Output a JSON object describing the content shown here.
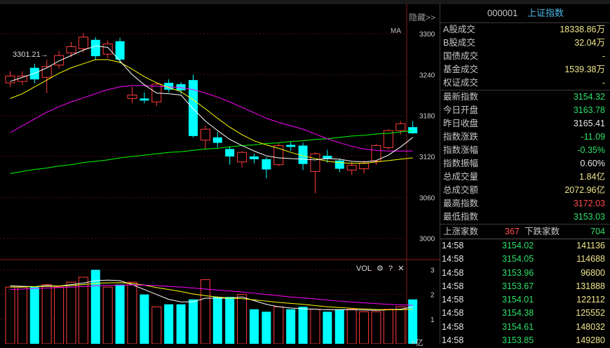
{
  "chart": {
    "hide_label": "隐藏>>",
    "ma_label": "MA",
    "peak_label": "3301.21→",
    "unit_label": "亿",
    "vol_label": "VOL",
    "settings_icon": "gear-icon",
    "help_label": "?",
    "close_label": "✕",
    "colors": {
      "up": "#ff3b3b",
      "down": "#00ffff",
      "ma5": "#ffffff",
      "ma10": "#ffff00",
      "ma20": "#ff00ff",
      "ma60": "#00ff00",
      "grid": "#4a1010"
    }
  },
  "chart_data": [
    {
      "type": "candlestick",
      "title": "",
      "y_ticks": [
        3000,
        3060,
        3120,
        3180,
        3240,
        3300
      ],
      "ylim": [
        2975,
        3335
      ],
      "candles": [
        {
          "o": 3228,
          "c": 3238,
          "h": 3245,
          "l": 3222
        },
        {
          "o": 3230,
          "c": 3238,
          "h": 3245,
          "l": 3225
        },
        {
          "o": 3250,
          "c": 3233,
          "h": 3256,
          "l": 3227
        },
        {
          "o": 3236,
          "c": 3252,
          "h": 3262,
          "l": 3213
        },
        {
          "o": 3254,
          "c": 3268,
          "h": 3275,
          "l": 3249
        },
        {
          "o": 3272,
          "c": 3281,
          "h": 3288,
          "l": 3266
        },
        {
          "o": 3278,
          "c": 3295,
          "h": 3301,
          "l": 3272
        },
        {
          "o": 3291,
          "c": 3267,
          "h": 3295,
          "l": 3261
        },
        {
          "o": 3270,
          "c": 3285,
          "h": 3290,
          "l": 3264
        },
        {
          "o": 3289,
          "c": 3262,
          "h": 3294,
          "l": 3257
        },
        {
          "o": 3205,
          "c": 3210,
          "h": 3222,
          "l": 3198
        },
        {
          "o": 3205,
          "c": 3202,
          "h": 3214,
          "l": 3198
        },
        {
          "o": 3200,
          "c": 3226,
          "h": 3228,
          "l": 3194
        },
        {
          "o": 3228,
          "c": 3218,
          "h": 3233,
          "l": 3214
        },
        {
          "o": 3226,
          "c": 3217,
          "h": 3229,
          "l": 3212
        },
        {
          "o": 3232,
          "c": 3150,
          "h": 3240,
          "l": 3148
        },
        {
          "o": 3144,
          "c": 3160,
          "h": 3165,
          "l": 3130
        },
        {
          "o": 3148,
          "c": 3140,
          "h": 3156,
          "l": 3133
        },
        {
          "o": 3131,
          "c": 3120,
          "h": 3135,
          "l": 3108
        },
        {
          "o": 3112,
          "c": 3126,
          "h": 3128,
          "l": 3104
        },
        {
          "o": 3120,
          "c": 3116,
          "h": 3124,
          "l": 3110
        },
        {
          "o": 3116,
          "c": 3101,
          "h": 3119,
          "l": 3088
        },
        {
          "o": 3108,
          "c": 3136,
          "h": 3140,
          "l": 3106
        },
        {
          "o": 3137,
          "c": 3134,
          "h": 3142,
          "l": 3128
        },
        {
          "o": 3136,
          "c": 3109,
          "h": 3140,
          "l": 3100
        },
        {
          "o": 3098,
          "c": 3124,
          "h": 3126,
          "l": 3066
        },
        {
          "o": 3121,
          "c": 3117,
          "h": 3130,
          "l": 3111
        },
        {
          "o": 3114,
          "c": 3102,
          "h": 3117,
          "l": 3097
        },
        {
          "o": 3100,
          "c": 3107,
          "h": 3112,
          "l": 3093
        },
        {
          "o": 3102,
          "c": 3110,
          "h": 3114,
          "l": 3095
        },
        {
          "o": 3113,
          "c": 3136,
          "h": 3138,
          "l": 3108
        },
        {
          "o": 3133,
          "c": 3158,
          "h": 3160,
          "l": 3130
        },
        {
          "o": 3158,
          "c": 3168,
          "h": 3172,
          "l": 3152
        },
        {
          "o": 3163,
          "c": 3154,
          "h": 3172,
          "l": 3153
        }
      ],
      "ma5": [
        3230,
        3236,
        3242,
        3250,
        3260,
        3268,
        3276,
        3282,
        3280,
        3260,
        3240,
        3225,
        3213,
        3212,
        3210,
        3190,
        3172,
        3158,
        3145,
        3136,
        3128,
        3121,
        3118,
        3117,
        3116,
        3115,
        3117,
        3116,
        3113,
        3112,
        3114,
        3122,
        3134,
        3148
      ],
      "ma10": [
        3205,
        3212,
        3222,
        3232,
        3242,
        3250,
        3256,
        3262,
        3262,
        3258,
        3248,
        3237,
        3228,
        3221,
        3215,
        3203,
        3190,
        3176,
        3163,
        3152,
        3143,
        3137,
        3132,
        3126,
        3121,
        3117,
        3113,
        3111,
        3110,
        3110,
        3112,
        3114,
        3116,
        3118
      ],
      "ma20": [
        3155,
        3165,
        3175,
        3185,
        3193,
        3200,
        3206,
        3212,
        3218,
        3222,
        3224,
        3224,
        3223,
        3222,
        3221,
        3218,
        3213,
        3207,
        3200,
        3192,
        3184,
        3176,
        3170,
        3165,
        3160,
        3153,
        3146,
        3140,
        3135,
        3131,
        3129,
        3128,
        3128,
        3128
      ],
      "ma60": [
        3095,
        3098,
        3101,
        3103,
        3106,
        3108,
        3111,
        3113,
        3115,
        3118,
        3120,
        3122,
        3124,
        3126,
        3127,
        3129,
        3131,
        3132,
        3134,
        3136,
        3137,
        3139,
        3140,
        3142,
        3143,
        3145,
        3146,
        3148,
        3150,
        3151,
        3153,
        3154,
        3156,
        3158
      ]
    },
    {
      "type": "bar",
      "title": "VOL",
      "y_ticks": [
        1,
        2,
        3
      ],
      "ylim": [
        0,
        3.3
      ],
      "values": [
        2.3,
        2.3,
        2.3,
        2.4,
        2.3,
        2.5,
        2.7,
        3.0,
        2.3,
        2.4,
        2.5,
        2.0,
        1.5,
        1.6,
        1.6,
        1.8,
        2.6,
        1.9,
        1.9,
        2.0,
        1.4,
        1.3,
        1.5,
        1.4,
        1.5,
        1.4,
        1.3,
        1.4,
        1.4,
        1.3,
        1.3,
        1.4,
        1.5,
        1.8
      ],
      "ma5": [
        2.35,
        2.33,
        2.32,
        2.36,
        2.34,
        2.4,
        2.46,
        2.56,
        2.58,
        2.56,
        2.4,
        2.2,
        2.0,
        1.8,
        1.7,
        1.7,
        1.85,
        1.85,
        1.85,
        1.9,
        1.75,
        1.6,
        1.5,
        1.45,
        1.42,
        1.4,
        1.38,
        1.38,
        1.38,
        1.37,
        1.36,
        1.38,
        1.4,
        1.5
      ],
      "ma10": [
        2.3,
        2.3,
        2.32,
        2.33,
        2.34,
        2.36,
        2.4,
        2.45,
        2.47,
        2.48,
        2.45,
        2.38,
        2.28,
        2.2,
        2.12,
        2.02,
        1.95,
        1.9,
        1.85,
        1.83,
        1.78,
        1.73,
        1.68,
        1.64,
        1.6,
        1.55,
        1.5,
        1.47,
        1.44,
        1.41,
        1.39,
        1.38,
        1.38,
        1.4
      ],
      "ma20": [
        2.2,
        2.22,
        2.24,
        2.26,
        2.28,
        2.3,
        2.32,
        2.35,
        2.37,
        2.38,
        2.39,
        2.38,
        2.36,
        2.33,
        2.3,
        2.26,
        2.22,
        2.18,
        2.14,
        2.1,
        2.05,
        2.0,
        1.95,
        1.9,
        1.86,
        1.82,
        1.77,
        1.73,
        1.69,
        1.66,
        1.63,
        1.6,
        1.58,
        1.56
      ]
    }
  ],
  "panel": {
    "code": "000001",
    "name": "上证指数",
    "turnover": [
      {
        "label": "A股成交",
        "value": "18338.86万",
        "color": "yellow"
      },
      {
        "label": "B股成交",
        "value": "32.04万",
        "color": "yellow"
      },
      {
        "label": "国债成交",
        "value": "-",
        "color": "yellow"
      },
      {
        "label": "基金成交",
        "value": "1539.38万",
        "color": "yellow"
      },
      {
        "label": "权证成交",
        "value": "-",
        "color": "yellow"
      }
    ],
    "stats": [
      {
        "label": "最新指数",
        "value": "3154.32",
        "color": "green"
      },
      {
        "label": "今日开盘",
        "value": "3163.78",
        "color": "green"
      },
      {
        "label": "昨日收盘",
        "value": "3165.41",
        "color": "white"
      },
      {
        "label": "指数涨跌",
        "value": "-11.09",
        "color": "green"
      },
      {
        "label": "指数涨幅",
        "value": "-0.35%",
        "color": "green"
      },
      {
        "label": "指数振幅",
        "value": "0.60%",
        "color": "white"
      },
      {
        "label": "总成交量",
        "value": "1.84亿",
        "color": "yellow"
      },
      {
        "label": "总成交额",
        "value": "2072.96亿",
        "color": "yellow"
      },
      {
        "label": "最高指数",
        "value": "3172.03",
        "color": "red"
      },
      {
        "label": "最低指数",
        "value": "3153.03",
        "color": "green"
      }
    ],
    "up_label": "上涨家数",
    "up_count": "367",
    "down_label": "下跌家数",
    "down_count": "704",
    "ticks": [
      {
        "time": "14:58",
        "price": "3154.02",
        "vol": "141136"
      },
      {
        "time": "14:58",
        "price": "3154.05",
        "vol": "114688"
      },
      {
        "time": "14:58",
        "price": "3153.96",
        "vol": "96800"
      },
      {
        "time": "14:58",
        "price": "3153.67",
        "vol": "131888"
      },
      {
        "time": "14:58",
        "price": "3154.01",
        "vol": "122112"
      },
      {
        "time": "14:58",
        "price": "3154.38",
        "vol": "125552"
      },
      {
        "time": "14:58",
        "price": "3154.61",
        "vol": "148032"
      },
      {
        "time": "14:58",
        "price": "3153.85",
        "vol": "149280"
      }
    ]
  }
}
